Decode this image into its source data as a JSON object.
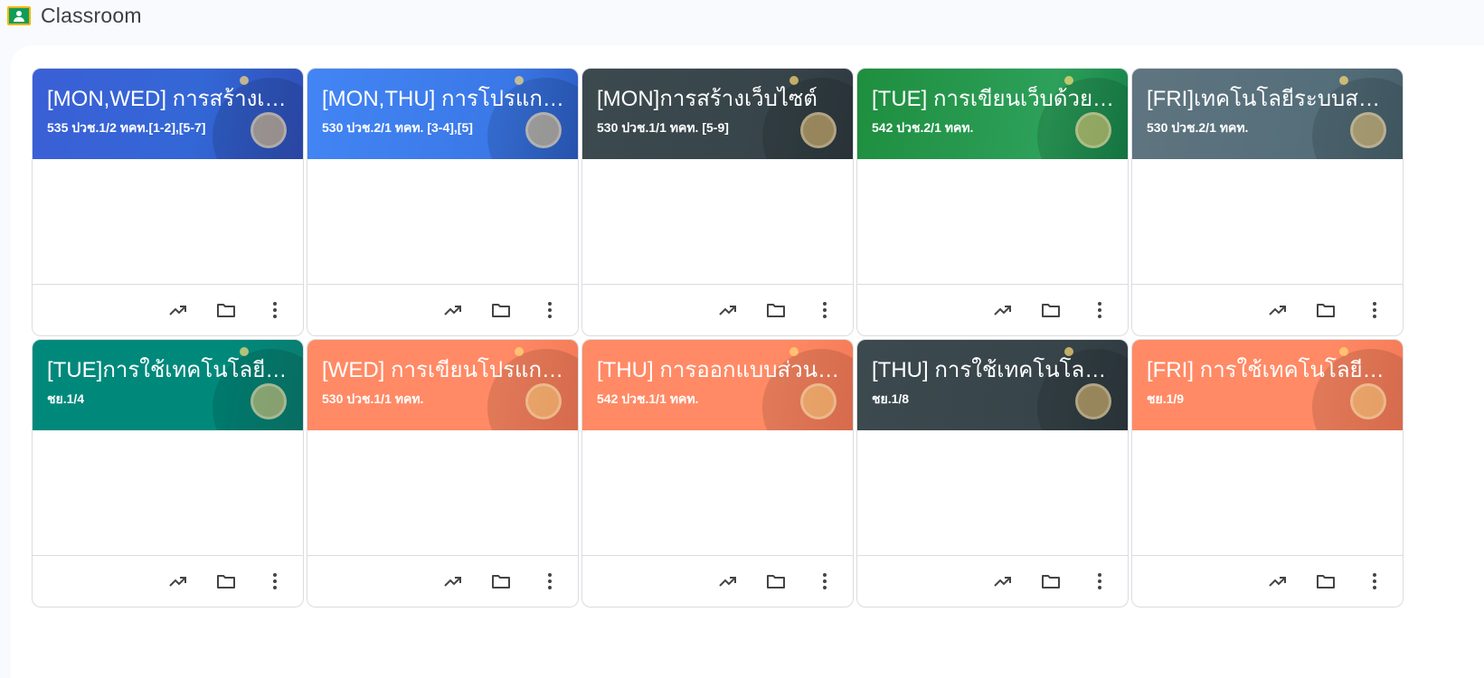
{
  "app": {
    "title": "Classroom"
  },
  "colors": {
    "blue": "#3367d6",
    "blue_bright": "#4285f4",
    "slate": "#3c4a4f",
    "green": "#1e8e3e",
    "grey_blue": "#546e7a",
    "teal": "#00897b",
    "orange": "#ff8a65"
  },
  "cards": [
    {
      "title": "[MON,WED] การสร้างเว็บ...",
      "subtitle": "535 ปวช.1/2 ทคท.[1-2],[5-7]",
      "theme": "blue"
    },
    {
      "title": "[MON,THU] การโปรแกรม...",
      "subtitle": "530 ปวช.2/1 ทคท. [3-4],[5]",
      "theme": "blue_bright"
    },
    {
      "title": "[MON]การสร้างเว็บไซต์",
      "subtitle": "530 ปวช.1/1 ทคท. [5-9]",
      "theme": "slate"
    },
    {
      "title": "[TUE] การเขียนเว็บด้วยบูท...",
      "subtitle": "542 ปวช.2/1 ทคท.",
      "theme": "green"
    },
    {
      "title": "[FRI]เทคโนโลยีระบบสมอง...",
      "subtitle": "530 ปวช.2/1 ทคท.",
      "theme": "grey_blue"
    },
    {
      "title": "[TUE]การใช้เทคโนโลยีดิจิ...",
      "subtitle": "ชย.1/4",
      "theme": "teal"
    },
    {
      "title": "[WED] การเขียนโปรแกรม...",
      "subtitle": "530 ปวช.1/1 ทคท.",
      "theme": "orange"
    },
    {
      "title": "[THU] การออกแบบส่วนติ...",
      "subtitle": "542 ปวช.1/1 ทคท.",
      "theme": "orange"
    },
    {
      "title": "[THU] การใช้เทคโนโลยีดิจิ...",
      "subtitle": "ชย.1/8",
      "theme": "slate"
    },
    {
      "title": "[FRI] การใช้เทคโนโลยีดิจิทั...",
      "subtitle": "ชย.1/9",
      "theme": "orange"
    }
  ],
  "footer_icons": [
    "trending-up-icon",
    "folder-icon",
    "more-vert-icon"
  ]
}
